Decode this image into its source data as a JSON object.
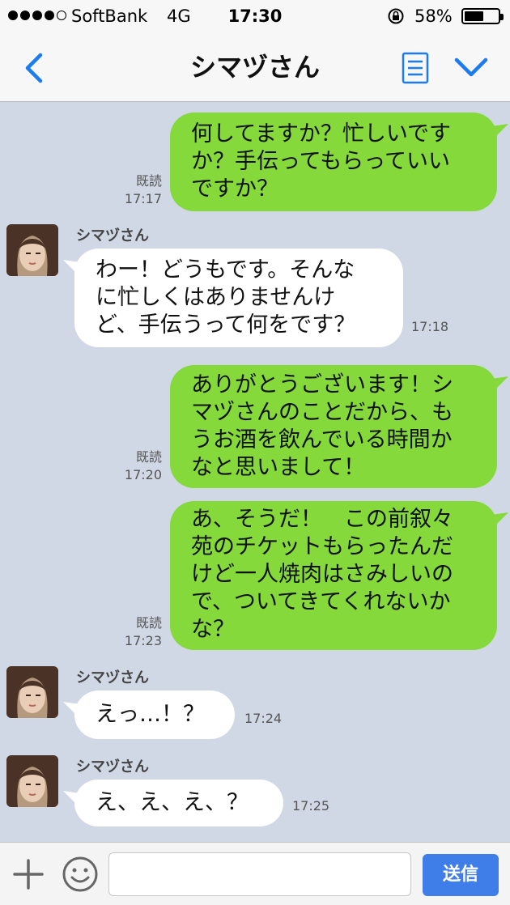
{
  "status_bar": {
    "carrier": "SoftBank",
    "network": "4G",
    "time": "17:30",
    "battery": "58%",
    "battery_level": 0.58
  },
  "header": {
    "title": "シマヅさん",
    "back_icon": "chevron-left-icon",
    "notes_icon": "notes-icon",
    "menu_icon": "chevron-down-icon",
    "accent_color": "#1a7cf0"
  },
  "messages": [
    {
      "direction": "out",
      "lines": [
        "何してますか？忙しいです",
        "か？手伝ってもらっていい",
        "ですか？"
      ],
      "read": "既読",
      "time": "17:17"
    },
    {
      "direction": "in",
      "sender": "シマヅさん",
      "lines": [
        "わー！どうもです。そんな",
        "に忙しくはありませんけ",
        "ど、手伝うって何をです？"
      ],
      "time": "17:18"
    },
    {
      "direction": "out",
      "lines": [
        "ありがとうございます！シ",
        "マヅさんのことだから、も",
        "うお酒を飲んでいる時間か",
        "なと思いまして！"
      ],
      "read": "既読",
      "time": "17:20"
    },
    {
      "direction": "out",
      "lines": [
        "あ、そうだ！　この前叙々",
        "苑のチケットもらったんだ",
        "けど一人焼肉はさみしいの",
        "で、ついてきてくれないか",
        "な？"
      ],
      "read": "既読",
      "time": "17:23"
    },
    {
      "direction": "in",
      "sender": "シマヅさん",
      "lines": [
        "えっ…！？"
      ],
      "time": "17:24"
    },
    {
      "direction": "in",
      "sender": "シマヅさん",
      "lines": [
        "え、え、え、？"
      ],
      "time": "17:25"
    }
  ],
  "input_bar": {
    "placeholder": "",
    "send_label": "送信",
    "send_color": "#3f7de8"
  },
  "colors": {
    "chat_background": "#cfd8e4",
    "outgoing_bubble": "#85d93a",
    "incoming_bubble": "#ffffff"
  }
}
